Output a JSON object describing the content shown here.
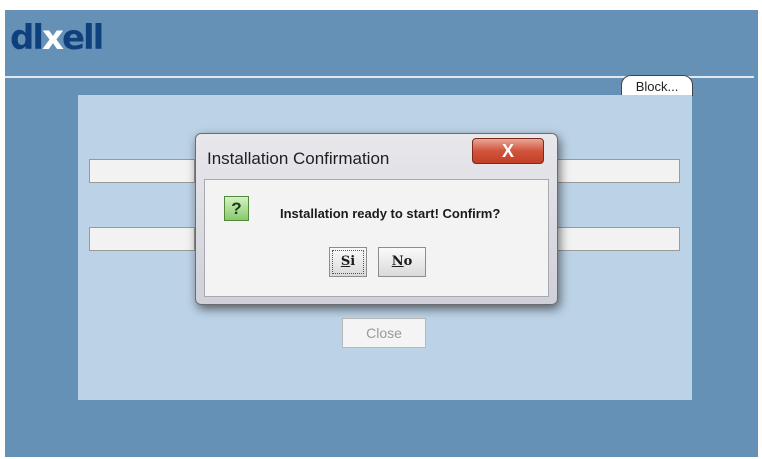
{
  "brand": {
    "logo_left": "dl",
    "logo_mid": "x",
    "logo_right": "ell"
  },
  "header": {
    "block_tab_label": "Block..."
  },
  "main": {
    "fields": [
      "",
      "",
      "",
      ""
    ],
    "close_label": "Close"
  },
  "dialog": {
    "title": "Installation Confirmation",
    "close_glyph": "X",
    "icon_glyph": "?",
    "message": "Installation ready to start! Confirm?",
    "yes_mnemonic": "S",
    "yes_rest": "i",
    "no_mnemonic": "N",
    "no_rest": "o"
  },
  "colors": {
    "app_background": "#6591b6",
    "panel": "#bcd2e6",
    "logo": "#103f7e",
    "close_button_red": "#c23f25",
    "question_icon": "#89c96e"
  },
  "icons": {
    "question": "question-icon",
    "close": "close-icon"
  }
}
